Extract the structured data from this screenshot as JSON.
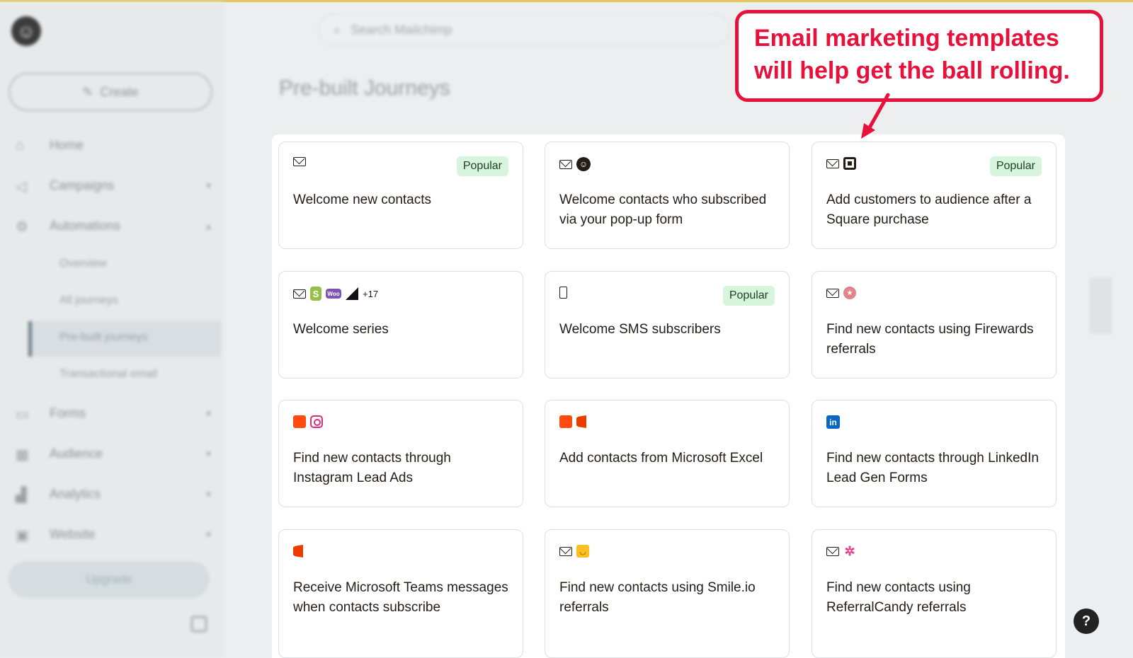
{
  "sidebar": {
    "create_label": "Create",
    "nav": [
      {
        "label": "Home"
      },
      {
        "label": "Campaigns"
      },
      {
        "label": "Automations"
      },
      {
        "label": "Forms"
      },
      {
        "label": "Audience"
      },
      {
        "label": "Analytics"
      },
      {
        "label": "Website"
      }
    ],
    "automation_sub": [
      {
        "label": "Overview"
      },
      {
        "label": "All journeys"
      },
      {
        "label": "Pre-built journeys"
      },
      {
        "label": "Transactional email"
      }
    ],
    "upgrade_label": "Upgrade"
  },
  "header": {
    "search_placeholder": "Search Mailchimp",
    "page_title": "Pre-built Journeys"
  },
  "cards": [
    {
      "title": "Welcome new contacts",
      "badge": "Popular",
      "icons": [
        "email-icon"
      ]
    },
    {
      "title": "Welcome contacts who subscribed via your pop-up form",
      "badge": "",
      "icons": [
        "email-icon",
        "mailchimp-icon"
      ]
    },
    {
      "title": "Add customers to audience after a Square purchase",
      "badge": "Popular",
      "icons": [
        "email-icon",
        "square-icon"
      ]
    },
    {
      "title": "Welcome series",
      "badge": "",
      "icons": [
        "email-icon",
        "shopify-icon",
        "woocommerce-icon",
        "bigcommerce-icon"
      ],
      "more": "+17"
    },
    {
      "title": "Welcome SMS subscribers",
      "badge": "Popular",
      "icons": [
        "phone-icon"
      ]
    },
    {
      "title": "Find new contacts using Firewards referrals",
      "badge": "",
      "icons": [
        "email-icon",
        "firewards-icon"
      ]
    },
    {
      "title": "Find new contacts through Instagram Lead Ads",
      "badge": "",
      "icons": [
        "lead-ads-icon",
        "instagram-icon"
      ]
    },
    {
      "title": "Add contacts from Microsoft Excel",
      "badge": "",
      "icons": [
        "lead-ads-icon",
        "office-icon"
      ]
    },
    {
      "title": "Find new contacts through LinkedIn Lead Gen Forms",
      "badge": "",
      "icons": [
        "linkedin-icon"
      ]
    },
    {
      "title": "Receive Microsoft Teams messages when contacts subscribe",
      "badge": "",
      "icons": [
        "office-icon"
      ]
    },
    {
      "title": "Find new contacts using Smile.io referrals",
      "badge": "",
      "icons": [
        "email-icon",
        "smile-io-icon"
      ]
    },
    {
      "title": "Find new contacts using ReferralCandy referrals",
      "badge": "",
      "icons": [
        "email-icon",
        "referralcandy-icon"
      ]
    }
  ],
  "callout": {
    "line1": "Email marketing templates",
    "line2": "will help get the ball rolling."
  },
  "colors": {
    "callout_red": "#e8113b",
    "badge_green": "#d6f5dc",
    "top_accent": "#e3c85a"
  }
}
